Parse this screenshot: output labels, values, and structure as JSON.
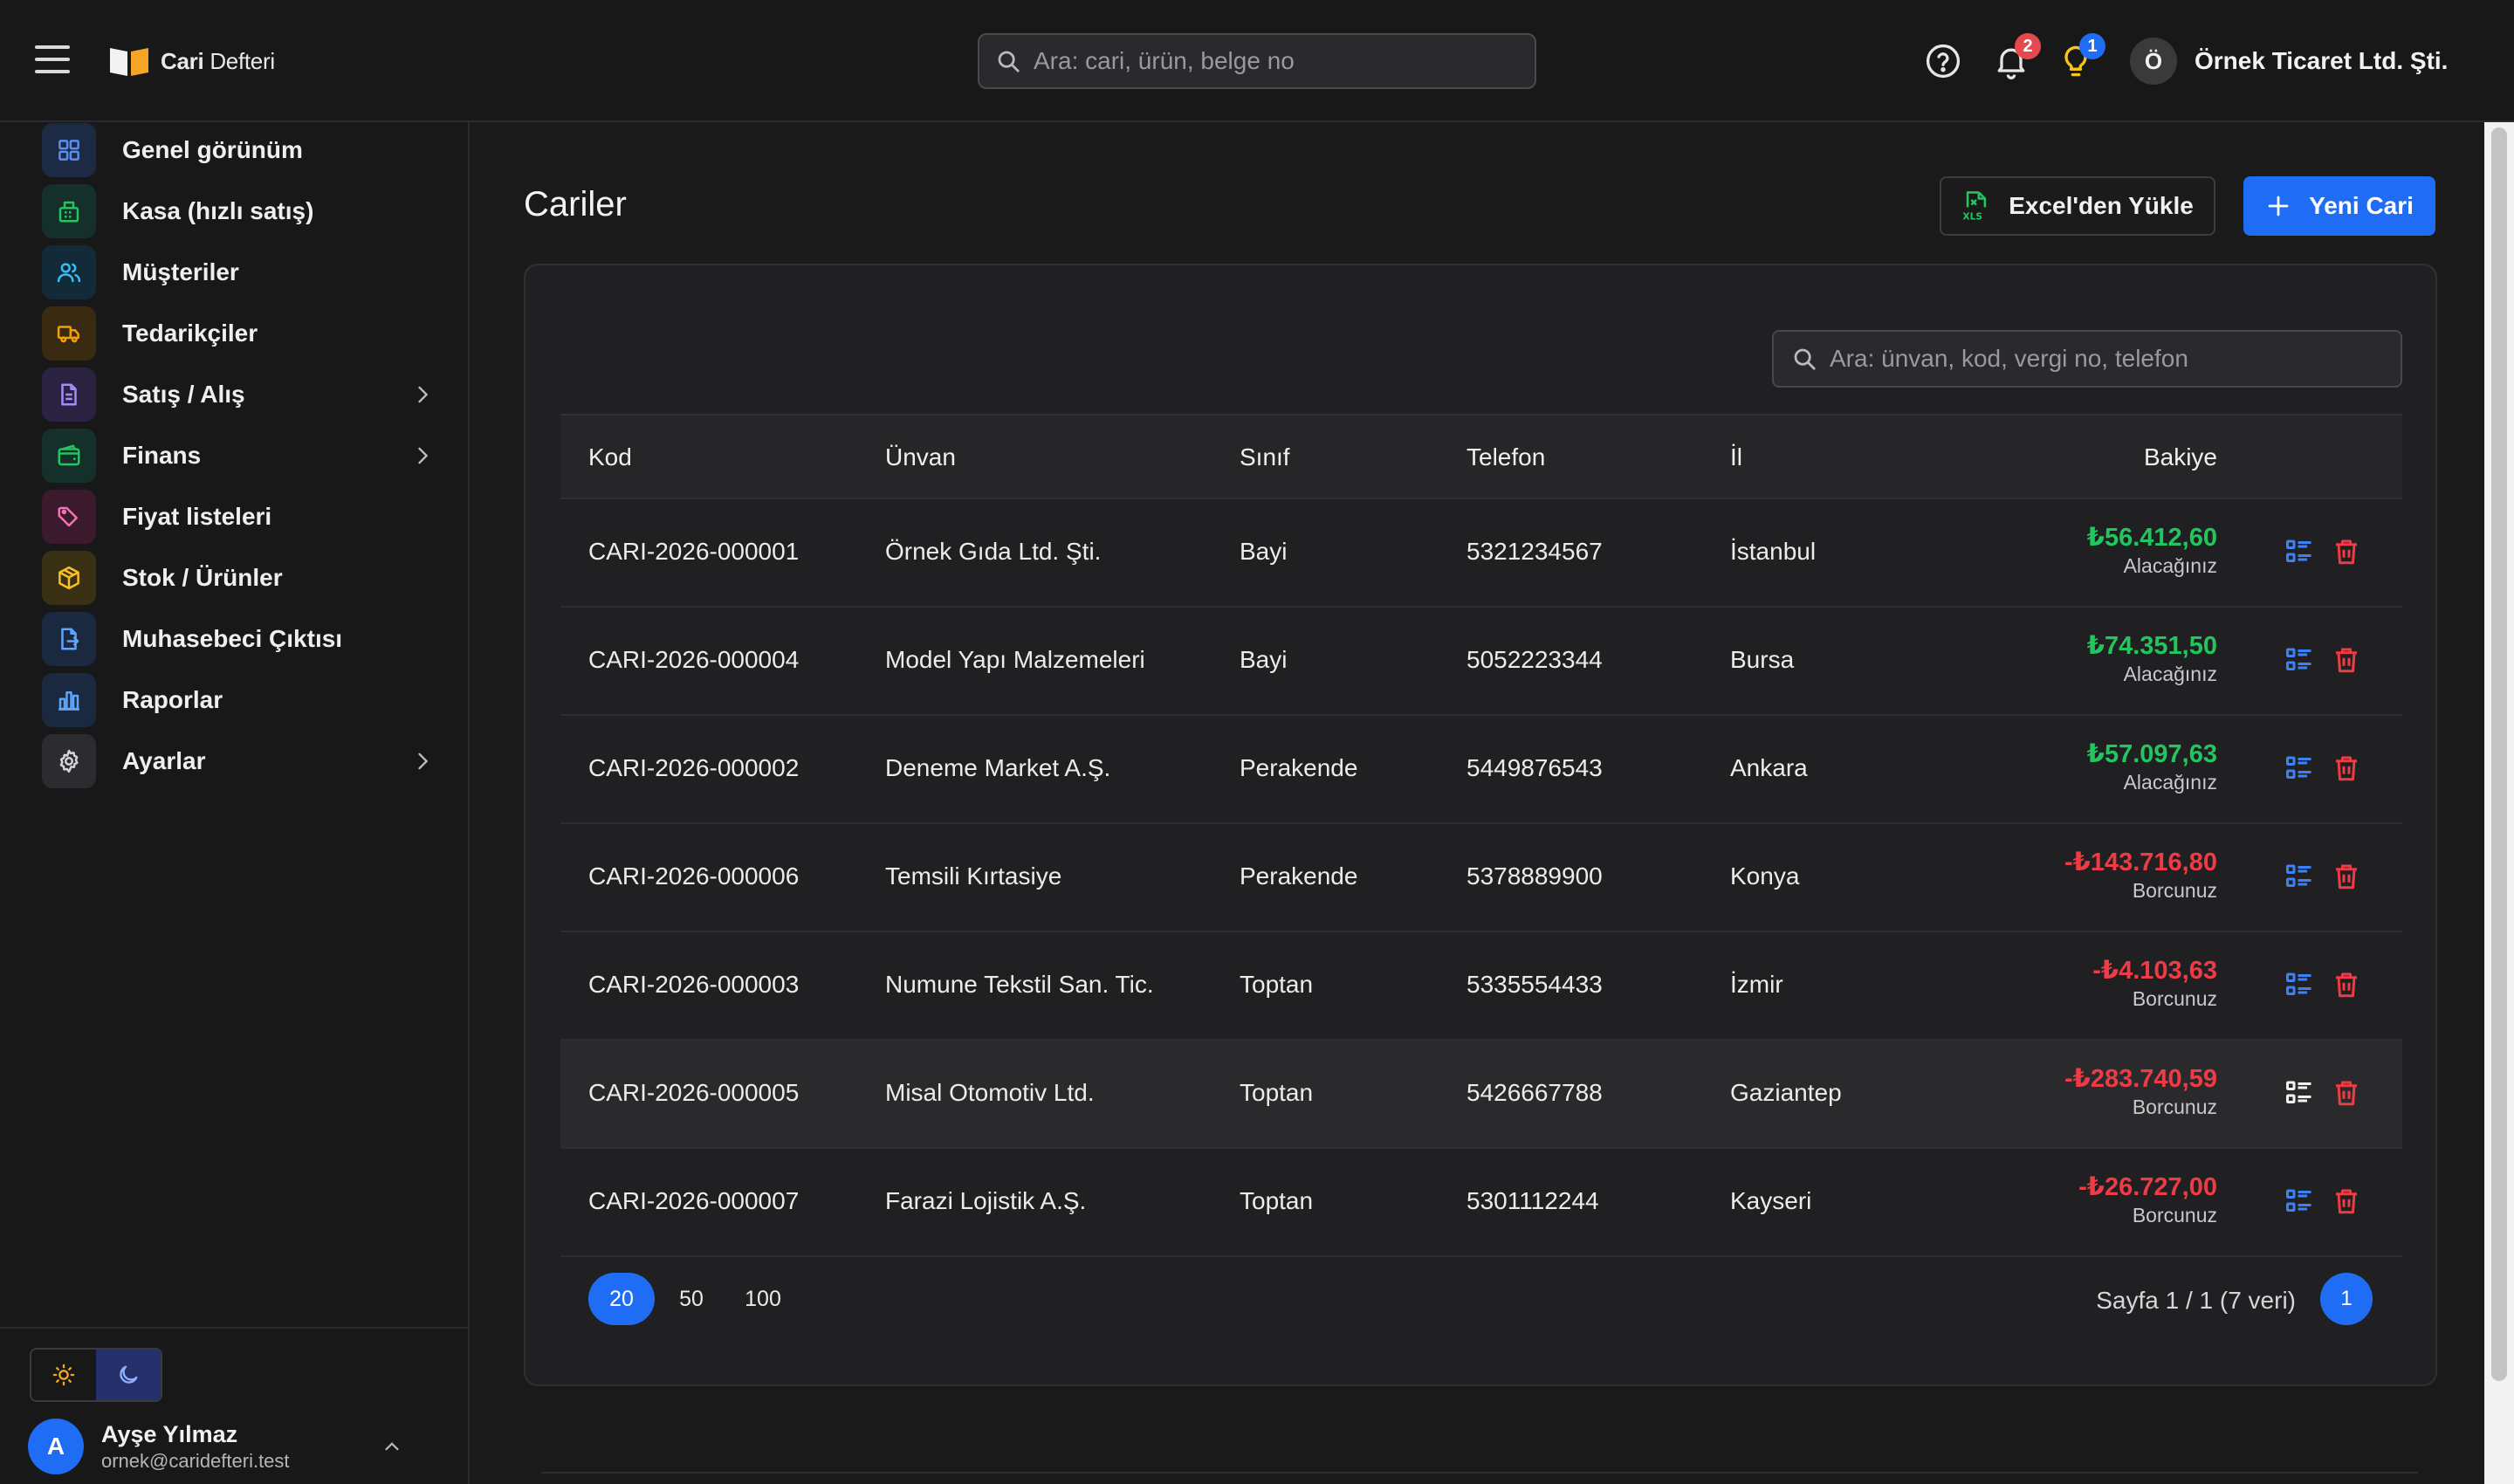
{
  "app": {
    "brand_bold": "Cari",
    "brand_light": "Defteri",
    "search_placeholder": "Ara: cari, ürün, belge no",
    "notifications_count": "2",
    "tips_count": "1",
    "company_initial": "Ö",
    "company_name": "Örnek Ticaret Ltd. Şti."
  },
  "sidebar": {
    "items": [
      {
        "label": "Genel görünüm",
        "icon": "dashboard-icon",
        "color": "#5b8def"
      },
      {
        "label": "Kasa (hızlı satış)",
        "icon": "cash-register-icon",
        "color": "#22c55e"
      },
      {
        "label": "Müşteriler",
        "icon": "users-icon",
        "color": "#38bdf8"
      },
      {
        "label": "Tedarikçiler",
        "icon": "truck-icon",
        "color": "#f59e0b"
      },
      {
        "label": "Satış / Alış",
        "icon": "document-icon",
        "color": "#a78bfa"
      },
      {
        "label": "Finans",
        "icon": "wallet-icon",
        "color": "#22c55e"
      },
      {
        "label": "Fiyat listeleri",
        "icon": "tags-icon",
        "color": "#f472b6"
      },
      {
        "label": "Stok / Ürünler",
        "icon": "box-icon",
        "color": "#fbbf24"
      },
      {
        "label": "Muhasebeci Çıktısı",
        "icon": "file-export-icon",
        "color": "#60a5fa"
      },
      {
        "label": "Raporlar",
        "icon": "bar-chart-icon",
        "color": "#60a5fa"
      },
      {
        "label": "Ayarlar",
        "icon": "gear-icon",
        "color": "#d4d4d8"
      }
    ]
  },
  "user": {
    "initial": "A",
    "name": "Ayşe Yılmaz",
    "email": "ornek@caridefteri.test"
  },
  "page": {
    "title": "Cariler",
    "excel_button": "Excel'den Yükle",
    "new_button": "Yeni Cari",
    "table_search_placeholder": "Ara: ünvan, kod, vergi no, telefon"
  },
  "table": {
    "columns": {
      "kod": "Kod",
      "unvan": "Ünvan",
      "sinif": "Sınıf",
      "telefon": "Telefon",
      "il": "İl",
      "bakiye": "Bakiye"
    },
    "rows": [
      {
        "kod": "CARI-2026-000001",
        "unvan": "Örnek Gıda Ltd. Şti.",
        "sinif": "Bayi",
        "telefon": "5321234567",
        "il": "İstanbul",
        "bakiye": "₺56.412,60",
        "durum": "Alacağınız",
        "positive": true
      },
      {
        "kod": "CARI-2026-000004",
        "unvan": "Model Yapı Malzemeleri",
        "sinif": "Bayi",
        "telefon": "5052223344",
        "il": "Bursa",
        "bakiye": "₺74.351,50",
        "durum": "Alacağınız",
        "positive": true
      },
      {
        "kod": "CARI-2026-000002",
        "unvan": "Deneme Market A.Ş.",
        "sinif": "Perakende",
        "telefon": "5449876543",
        "il": "Ankara",
        "bakiye": "₺57.097,63",
        "durum": "Alacağınız",
        "positive": true
      },
      {
        "kod": "CARI-2026-000006",
        "unvan": "Temsili Kırtasiye",
        "sinif": "Perakende",
        "telefon": "5378889900",
        "il": "Konya",
        "bakiye": "-₺143.716,80",
        "durum": "Borcunuz",
        "positive": false
      },
      {
        "kod": "CARI-2026-000003",
        "unvan": "Numune Tekstil San. Tic.",
        "sinif": "Toptan",
        "telefon": "5335554433",
        "il": "İzmir",
        "bakiye": "-₺4.103,63",
        "durum": "Borcunuz",
        "positive": false
      },
      {
        "kod": "CARI-2026-000005",
        "unvan": "Misal Otomotiv Ltd.",
        "sinif": "Toptan",
        "telefon": "5426667788",
        "il": "Gaziantep",
        "bakiye": "-₺283.740,59",
        "durum": "Borcunuz",
        "positive": false
      },
      {
        "kod": "CARI-2026-000007",
        "unvan": "Farazi Lojistik A.Ş.",
        "sinif": "Toptan",
        "telefon": "5301112244",
        "il": "Kayseri",
        "bakiye": "-₺26.727,00",
        "durum": "Borcunuz",
        "positive": false
      }
    ]
  },
  "pagination": {
    "sizes": [
      "20",
      "50",
      "100"
    ],
    "active_size": "20",
    "info": "Sayfa 1 / 1 (7 veri)",
    "current": "1"
  },
  "colors": {
    "accent": "#1f6cf5",
    "positive": "#22c55e",
    "negative": "#ef3b45"
  }
}
